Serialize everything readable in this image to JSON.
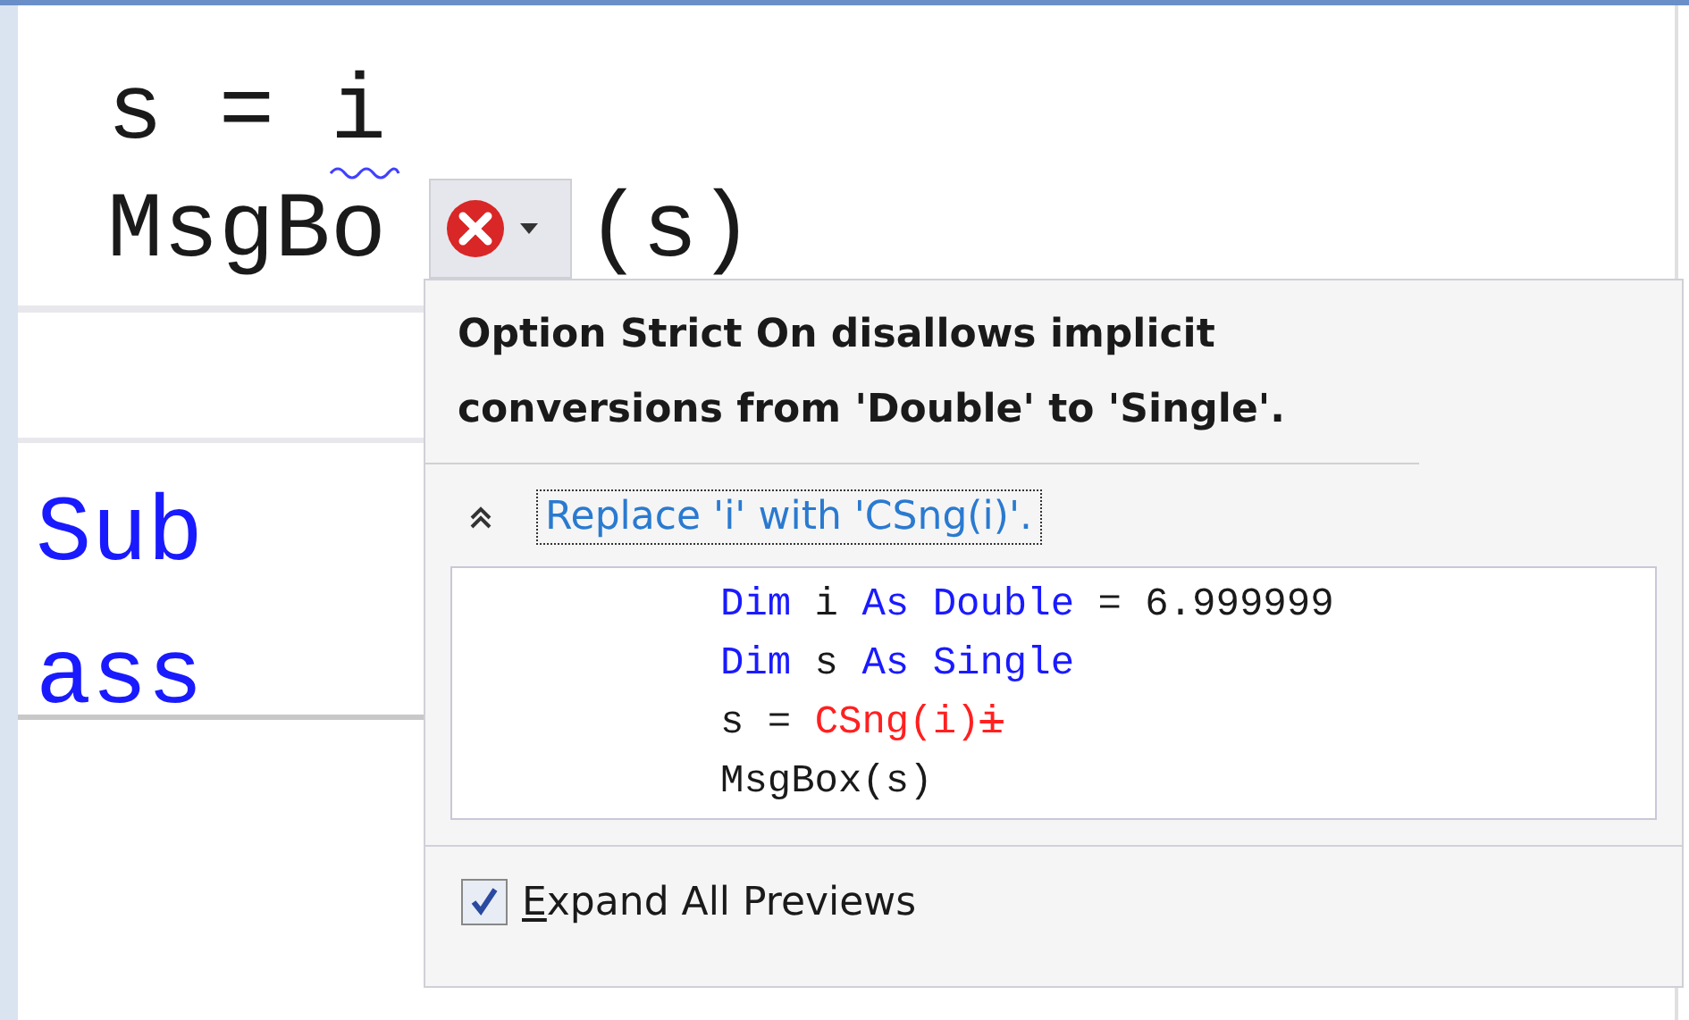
{
  "editor": {
    "lines": [
      {
        "tokens": [
          {
            "text": "s = i",
            "kind": "plain"
          }
        ],
        "squiggle": true
      },
      {
        "tokens": [
          {
            "text": "MsgBo",
            "kind": "plain"
          },
          {
            "text": "(s)",
            "kind": "covered"
          }
        ],
        "squiggle": false
      },
      {
        "tokens": [
          {
            "text": "Sub",
            "kind": "keyword"
          }
        ],
        "squiggle": false
      },
      {
        "tokens": [
          {
            "text": "ass",
            "kind": "keyword"
          }
        ],
        "squiggle": false
      }
    ]
  },
  "lightbulb": {
    "kind": "error"
  },
  "popup": {
    "message": "Option Strict On disallows implicit conversions from 'Double' to 'Single'.",
    "fix": {
      "label": "Replace 'i' with 'CSng(i)'.",
      "expanded": true
    },
    "preview": [
      {
        "tokens": [
          {
            "text": "Dim",
            "kind": "keyword"
          },
          {
            "text": " i ",
            "kind": "plain"
          },
          {
            "text": "As Double",
            "kind": "keyword"
          },
          {
            "text": " = 6.999999",
            "kind": "plain"
          }
        ]
      },
      {
        "tokens": [
          {
            "text": "Dim",
            "kind": "keyword"
          },
          {
            "text": " s ",
            "kind": "plain"
          },
          {
            "text": "As Single",
            "kind": "keyword"
          }
        ]
      },
      {
        "tokens": [
          {
            "text": "s = ",
            "kind": "plain"
          },
          {
            "text": "CSng(i)",
            "kind": "inserted"
          },
          {
            "text": "i",
            "kind": "deleted"
          }
        ]
      },
      {
        "tokens": [
          {
            "text": "MsgBox(s)",
            "kind": "plain"
          }
        ]
      }
    ],
    "checkbox": {
      "label": "Expand All Previews",
      "checked": true
    }
  }
}
